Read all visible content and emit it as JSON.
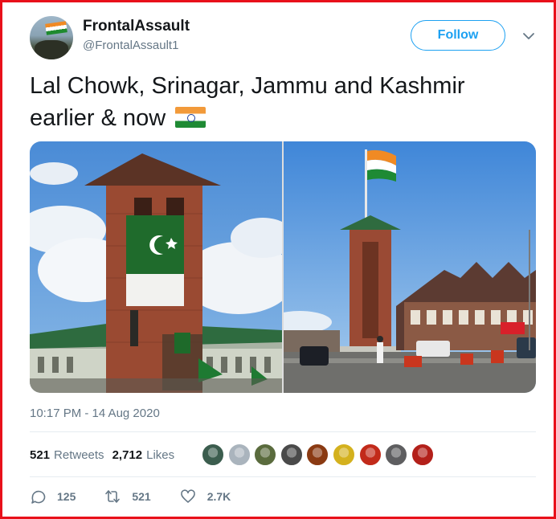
{
  "author": {
    "name": "FrontalAssault",
    "handle": "@FrontalAssault1",
    "avatar_icon": "avatar-icon"
  },
  "follow_label": "Follow",
  "tweet": {
    "text": "Lal Chowk, Srinagar, Jammu and Kashmir earlier & now",
    "emoji": "india-flag-icon"
  },
  "media": [
    {
      "description_icon": "photo-clock-tower-earlier"
    },
    {
      "description_icon": "photo-clock-tower-now"
    }
  ],
  "timestamp": "10:17 PM - 14 Aug 2020",
  "stats": {
    "retweets_count": "521",
    "retweets_label": "Retweets",
    "likes_count": "2,712",
    "likes_label": "Likes"
  },
  "liker_avatars": [
    "#3b5d4e",
    "#aab4bd",
    "#5a6b3d",
    "#4a4a4a",
    "#8a3a12",
    "#d4b11e",
    "#c22a1a",
    "#5e5e60",
    "#b3201a"
  ],
  "actions": {
    "reply_count": "125",
    "retweet_count": "521",
    "like_count": "2.7K"
  },
  "colors": {
    "accent": "#1da1f2",
    "border": "#e8101a",
    "muted": "#657786"
  }
}
